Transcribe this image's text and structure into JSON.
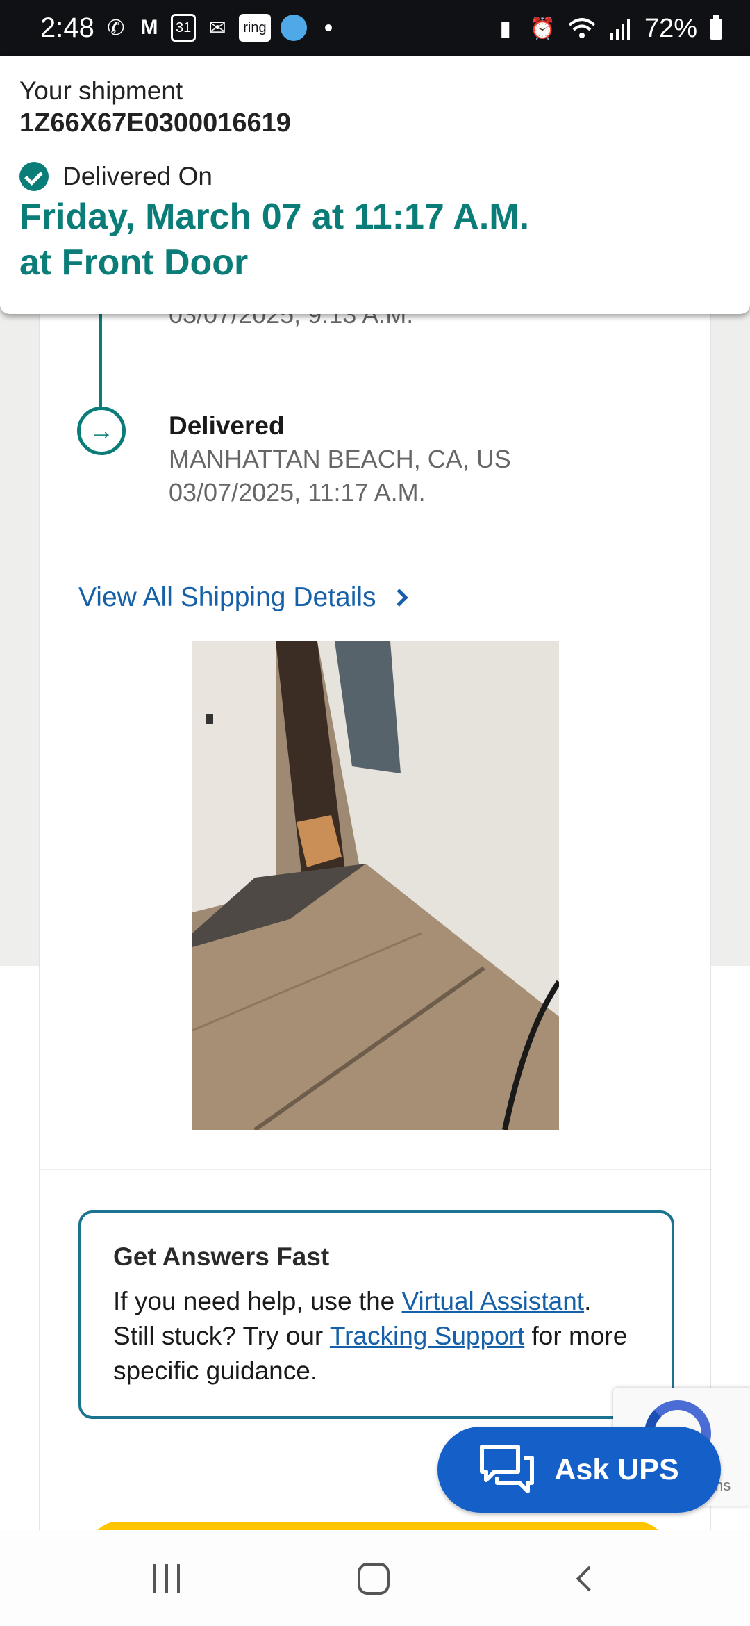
{
  "status_bar": {
    "time": "2:48",
    "battery": "72%",
    "icons_left": [
      "wifi-calling-icon",
      "gmail-icon",
      "calendar-icon",
      "messages-icon",
      "ring-icon",
      "location-icon",
      "dot-icon"
    ],
    "calendar_day": "31",
    "ring_label": "ring",
    "icons_right": [
      "battery-saver-icon",
      "alarm-icon",
      "wifi-icon",
      "signal-icon",
      "battery-icon"
    ]
  },
  "shipment": {
    "label": "Your shipment",
    "tracking_number": "1Z66X67E0300016619",
    "delivered_label": "Delivered On",
    "delivered_date": "Friday, March 07 at 11:17 A.M.",
    "delivered_place": "at Front Door"
  },
  "timeline": {
    "previous_timestamp": "03/07/2025, 9:13 A.M.",
    "event": {
      "status": "Delivered",
      "location": "MANHATTAN BEACH, CA, US",
      "timestamp": "03/07/2025, 11:17 A.M."
    }
  },
  "view_all_link": "View All Shipping Details",
  "help": {
    "title": "Get Answers Fast",
    "text_1": "If you need help, use the ",
    "link_1": "Virtual Assistant",
    "text_2": ". Still stuck? Try our ",
    "link_2": "Tracking Support",
    "text_3": " for more specific guidance."
  },
  "recaptcha_terms": "ms",
  "ask_ups": "Ask UPS",
  "colors": {
    "accent_teal": "#0b7d78",
    "link_blue": "#1560a8",
    "ask_button": "#1560c8",
    "help_border": "#1b7390",
    "cta_yellow": "#ffc400"
  }
}
